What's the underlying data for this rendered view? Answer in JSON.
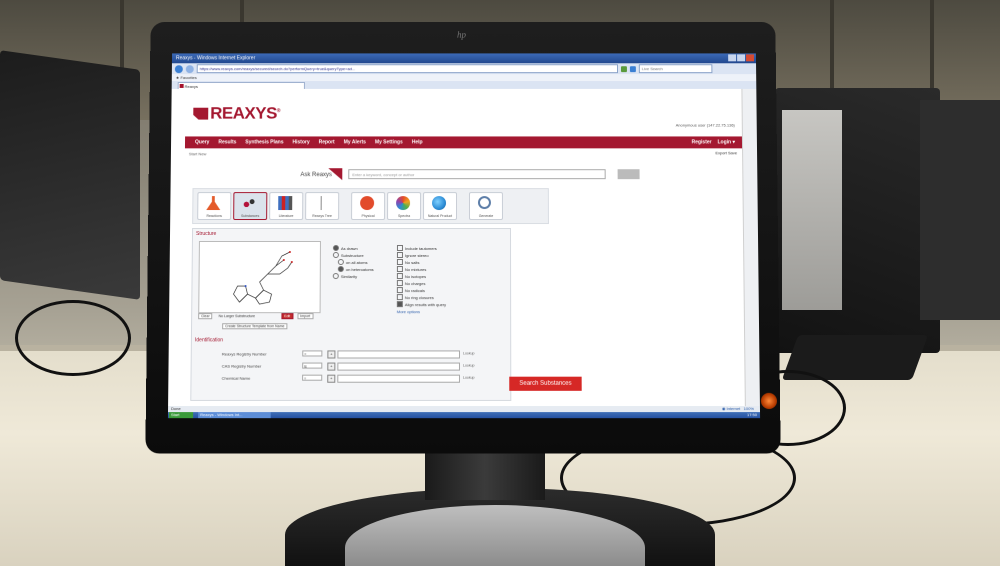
{
  "window": {
    "title": "Reaxys - Windows Internet Explorer",
    "url": "https://www.reaxys.com/reaxys/secured/search.do?performQuery=true&queryType=ad...",
    "search_placeholder": "Live Search",
    "tab_label": "Reaxys",
    "favorites_label": "Favorites"
  },
  "app": {
    "logo": "REAXYS",
    "anonymous_user": "Anonymous user (147.22.75.136)",
    "menu": [
      "Query",
      "Results",
      "Synthesis Plans",
      "History",
      "Report",
      "My Alerts",
      "My Settings",
      "Help"
    ],
    "menu_right": [
      "Register",
      "Login ▾"
    ],
    "start_new": "Start New",
    "export_label": "Export",
    "save_label": "Save",
    "ask_label": "Ask Reaxys",
    "ask_placeholder": "Enter a keyword, concept or author",
    "query_buttons": [
      {
        "label": "Reactions",
        "color": "#e45b2b"
      },
      {
        "label": "Substances",
        "color": "#b3123a"
      },
      {
        "label": "Literature",
        "color": "#3f6fbf"
      },
      {
        "label": "Reaxys Tree",
        "color": "#888888"
      },
      {
        "label": "Physical",
        "color": "#e24b2b"
      },
      {
        "label": "Spectra",
        "color": "#f2a21c"
      },
      {
        "label": "Natural Product",
        "color": "#2b8cd6"
      },
      {
        "label": "Generate",
        "color": "#5d7ea8"
      }
    ],
    "structure_title": "Structure",
    "search_as": [
      {
        "label": "As drawn",
        "selected": true
      },
      {
        "label": "Substructure",
        "selected": false
      },
      {
        "label": "on all atoms",
        "selected": false
      },
      {
        "label": "on heteroatoms",
        "selected": true
      },
      {
        "label": "Similarity",
        "selected": false
      }
    ],
    "options": [
      {
        "label": "Include tautomers",
        "checked": false
      },
      {
        "label": "Ignore stereo",
        "checked": false
      },
      {
        "label": "No salts",
        "checked": false
      },
      {
        "label": "No mixtures",
        "checked": false
      },
      {
        "label": "No isotopes",
        "checked": false
      },
      {
        "label": "No charges",
        "checked": false
      },
      {
        "label": "No radicals",
        "checked": false
      },
      {
        "label": "No ring closures",
        "checked": false
      },
      {
        "label": "Align results with query",
        "checked": true
      }
    ],
    "more_options": "More options",
    "struct_btns": [
      "Clear",
      "No Larger Substructure",
      "Edit",
      "Import"
    ],
    "create_btn": "Create Structure Template from Name",
    "identification_title": "Identification",
    "ident_rows": [
      {
        "label": "Reaxys Registry Number",
        "op": "=",
        "lookup": "Lookup"
      },
      {
        "label": "CAS Registry Number",
        "op": "is",
        "lookup": "Lookup"
      },
      {
        "label": "Chemical Name",
        "op": "=",
        "lookup": "Lookup"
      }
    ],
    "search_button": "Search Substances"
  },
  "status": {
    "left": "Done",
    "zone": "Internet",
    "zoom": "100%"
  },
  "taskbar": {
    "start": "Start",
    "item": "Reaxys - Windows Int...",
    "clock": "17:50"
  }
}
